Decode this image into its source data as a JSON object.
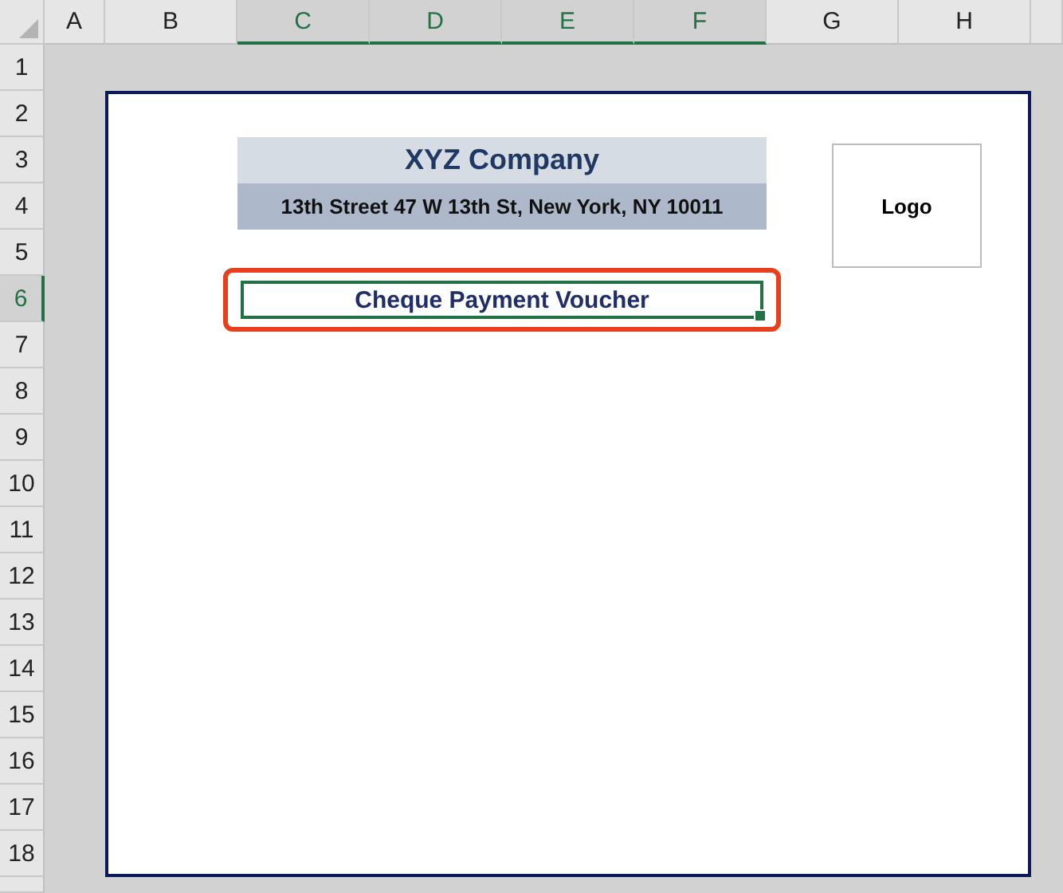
{
  "column_headers": [
    {
      "label": "A",
      "selected": false
    },
    {
      "label": "B",
      "selected": false
    },
    {
      "label": "C",
      "selected": true
    },
    {
      "label": "D",
      "selected": true
    },
    {
      "label": "E",
      "selected": true
    },
    {
      "label": "F",
      "selected": true
    },
    {
      "label": "G",
      "selected": false
    },
    {
      "label": "H",
      "selected": false
    }
  ],
  "row_headers": [
    {
      "label": "1",
      "selected": false
    },
    {
      "label": "2",
      "selected": false
    },
    {
      "label": "3",
      "selected": false
    },
    {
      "label": "4",
      "selected": false
    },
    {
      "label": "5",
      "selected": false
    },
    {
      "label": "6",
      "selected": true
    },
    {
      "label": "7",
      "selected": false
    },
    {
      "label": "8",
      "selected": false
    },
    {
      "label": "9",
      "selected": false
    },
    {
      "label": "10",
      "selected": false
    },
    {
      "label": "11",
      "selected": false
    },
    {
      "label": "12",
      "selected": false
    },
    {
      "label": "13",
      "selected": false
    },
    {
      "label": "14",
      "selected": false
    },
    {
      "label": "15",
      "selected": false
    },
    {
      "label": "16",
      "selected": false
    },
    {
      "label": "17",
      "selected": false
    },
    {
      "label": "18",
      "selected": false
    }
  ],
  "voucher": {
    "company": "XYZ Company",
    "address": "13th Street 47 W 13th St, New York, NY 10011",
    "logo": "Logo",
    "title": "Cheque Payment Voucher",
    "title_selected": true,
    "title_highlighted": true
  }
}
